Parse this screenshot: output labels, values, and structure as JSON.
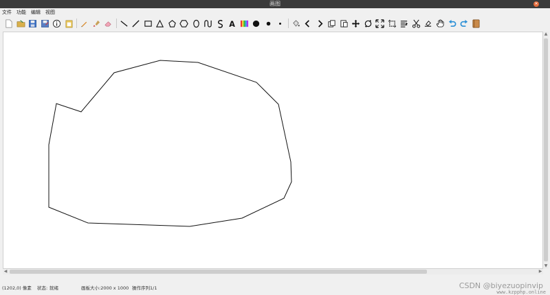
{
  "window": {
    "title": "画图"
  },
  "menu": {
    "items": [
      "文件",
      "功能",
      "编辑",
      "视图"
    ]
  },
  "toolbar": {
    "tools": [
      "new-file-icon",
      "open-file-icon",
      "save-icon",
      "save-as-icon",
      "info-icon",
      "paste-icon",
      "pen-icon",
      "brush-icon",
      "eraser-icon",
      "line-icon",
      "diagonal-line-icon",
      "rectangle-icon",
      "triangle-icon",
      "pentagon-icon",
      "polygon-icon",
      "ellipse-icon",
      "curve-icon",
      "s-curve-icon",
      "text-icon",
      "color-palette-icon",
      "large-dot-icon",
      "medium-dot-icon",
      "small-dot-icon",
      "fill-bucket-icon",
      "chevron-left-icon",
      "chevron-right-icon",
      "copy-icon",
      "paste-layer-icon",
      "move-icon",
      "rotate-icon",
      "scale-icon",
      "crop-icon",
      "align-icon",
      "cut-icon",
      "erase-area-icon",
      "pan-hand-icon",
      "undo-icon",
      "redo-icon",
      "palette-book-icon"
    ],
    "undo_color": "#2a8fd6",
    "redo_color": "#2a8fd6"
  },
  "canvas": {
    "background": "#ffffff",
    "stroke_color": "#111111"
  },
  "status": {
    "coords": "(1202,0) 像素",
    "state_label": "状态:",
    "state_value": "就绪",
    "canvas_size": "画板大小:2000 x 1000",
    "op_sequence": "操作序列1/1"
  },
  "watermark": {
    "text": "CSDN @biyezuopinvip",
    "sub": "www.kzpphp.online"
  }
}
